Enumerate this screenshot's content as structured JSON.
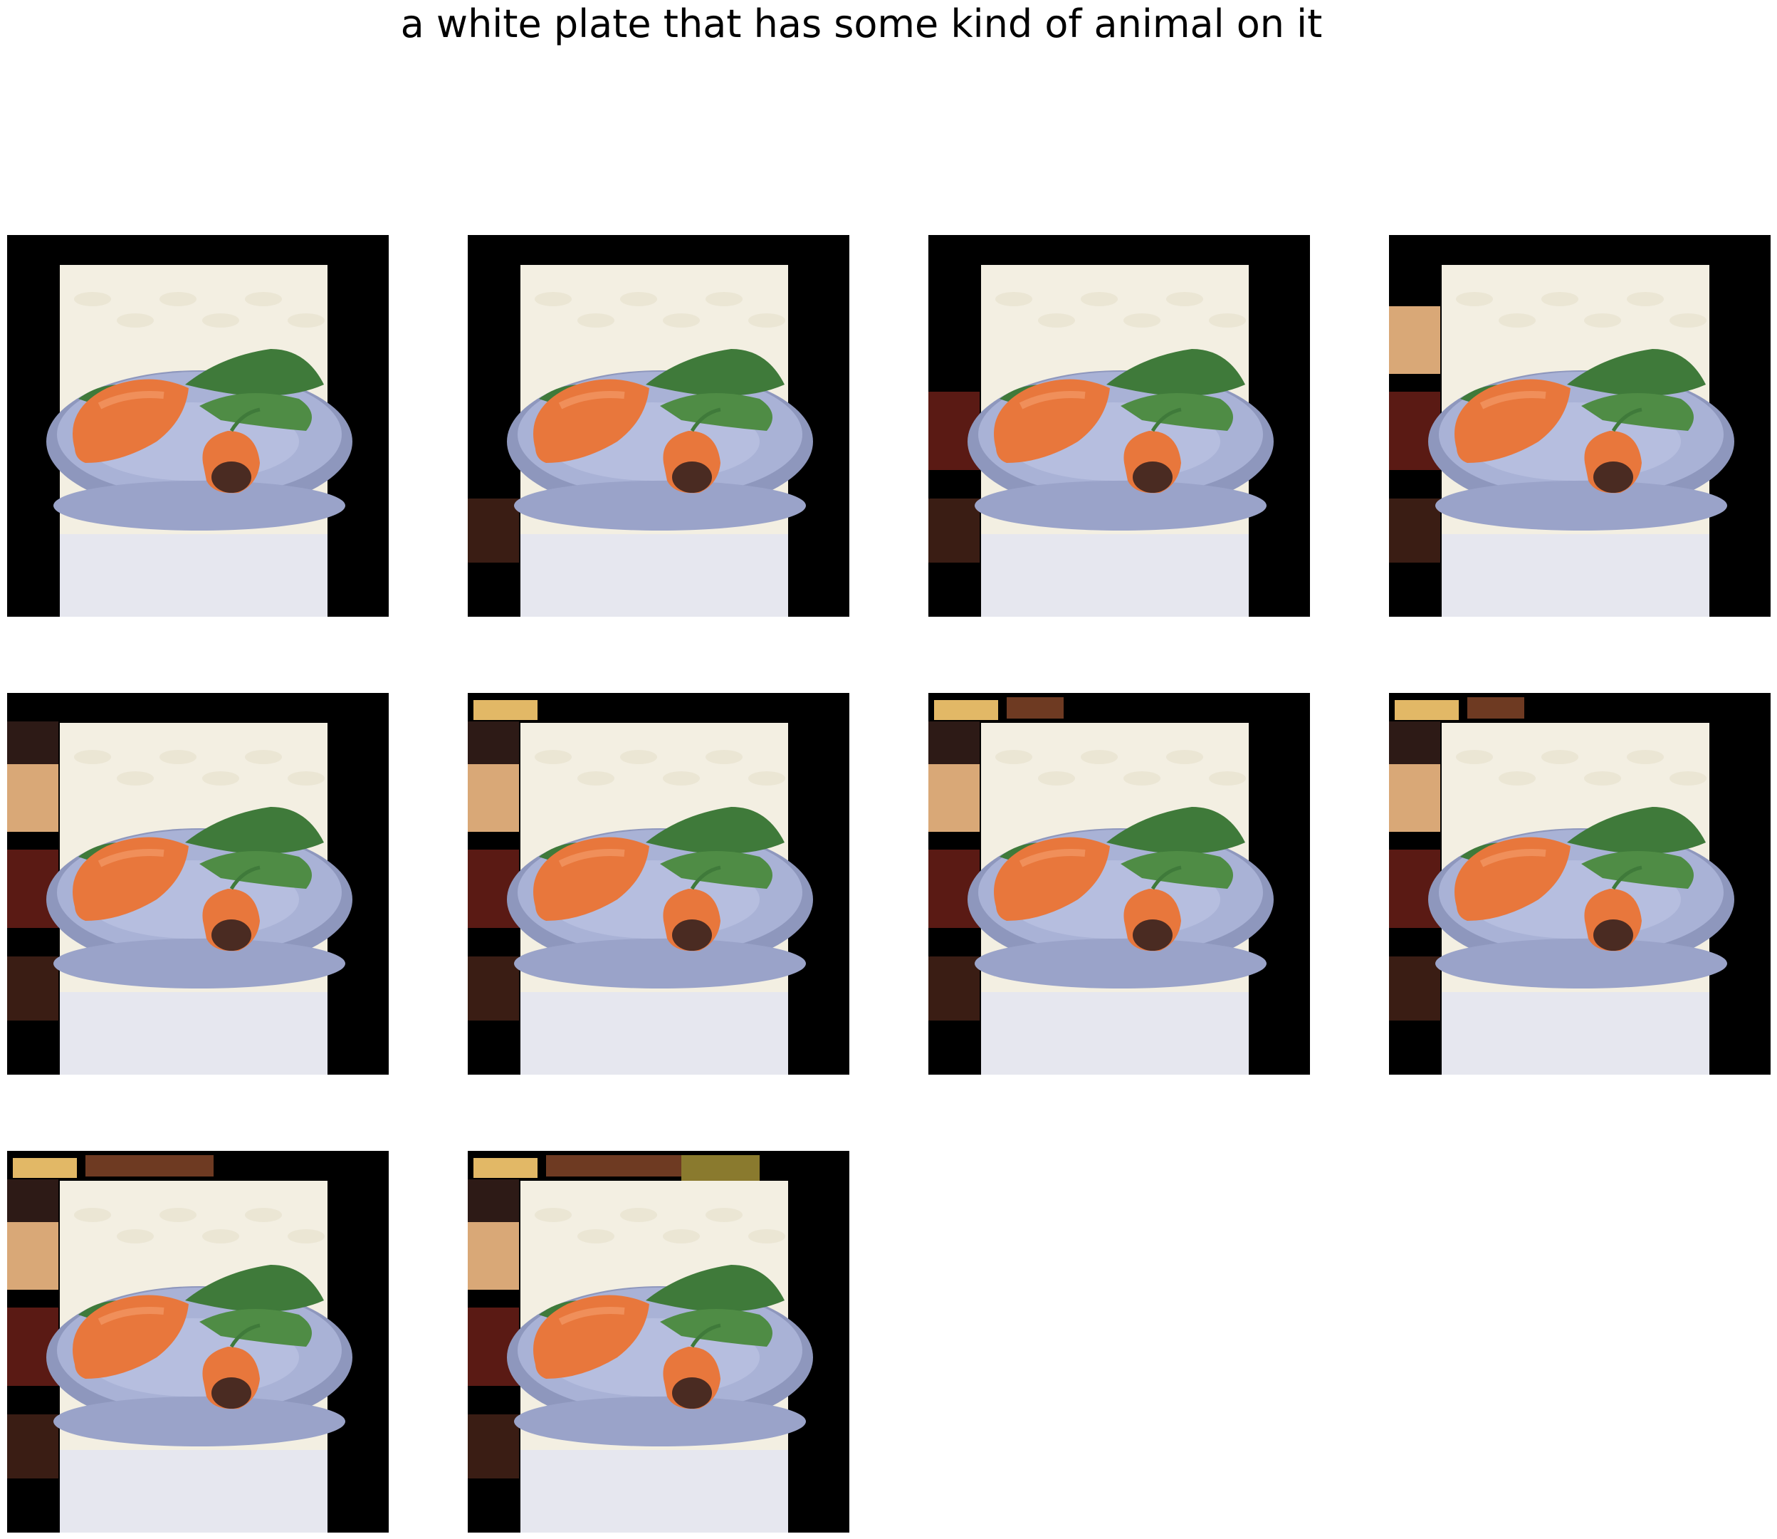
{
  "caption": "a white plate that has some kind of animal on it",
  "frames": [
    {
      "index": 1,
      "edge_artifacts": "none"
    },
    {
      "index": 2,
      "edge_artifacts": "left-bottom"
    },
    {
      "index": 3,
      "edge_artifacts": "left-middle"
    },
    {
      "index": 4,
      "edge_artifacts": "left-top"
    },
    {
      "index": 5,
      "edge_artifacts": "left-full"
    },
    {
      "index": 6,
      "edge_artifacts": "left-full-top-small"
    },
    {
      "index": 7,
      "edge_artifacts": "left-full-top-medium"
    },
    {
      "index": 8,
      "edge_artifacts": "left-full-top-medium"
    },
    {
      "index": 9,
      "edge_artifacts": "left-full-top-wide"
    },
    {
      "index": 10,
      "edge_artifacts": "left-full-top-wider"
    }
  ],
  "colors": {
    "background": "#ffffff",
    "frame_padding": "#000000",
    "tablecloth": "#f3efe2",
    "plate": "#a9b2d6",
    "carrot": "#e8773c",
    "greens": "#3f7a3a",
    "carrot_end": "#4a2b22"
  }
}
